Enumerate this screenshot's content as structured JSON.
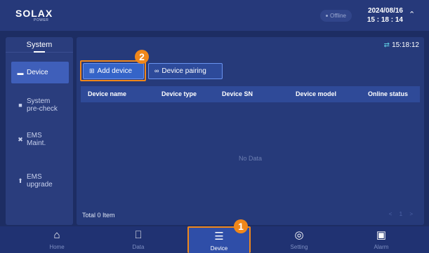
{
  "header": {
    "logo": "SOLAX",
    "logo_sub": "POWER",
    "status": "Offline",
    "date": "2024/08/16",
    "time": "15 : 18 : 14"
  },
  "sidebar": {
    "title": "System",
    "items": [
      {
        "label": "Device",
        "icon": "device-icon"
      },
      {
        "label": "System pre-check",
        "icon": "check-icon"
      },
      {
        "label": "EMS Maint.",
        "icon": "wrench-icon"
      },
      {
        "label": "EMS upgrade",
        "icon": "upgrade-icon"
      }
    ]
  },
  "main": {
    "clock": "15:18:12",
    "add_device": "Add device",
    "device_pairing": "Device pairing",
    "columns": [
      "Device name",
      "Device type",
      "Device SN",
      "Device model",
      "Online status"
    ],
    "empty_text": "No Data",
    "total": "Total 0 Item",
    "pager": "< 1 >"
  },
  "annotations": {
    "step_1": "1",
    "step_2": "2"
  },
  "bottom_nav": [
    {
      "label": "Home",
      "icon": "home-icon"
    },
    {
      "label": "Data",
      "icon": "chart-icon"
    },
    {
      "label": "Device",
      "icon": "device-icon"
    },
    {
      "label": "Setting",
      "icon": "settings-icon"
    },
    {
      "label": "Alarm",
      "icon": "alarm-icon"
    }
  ],
  "colors": {
    "accent_orange": "#f0871a",
    "primary_blue": "#3564c8",
    "background": "#1d2d63"
  }
}
